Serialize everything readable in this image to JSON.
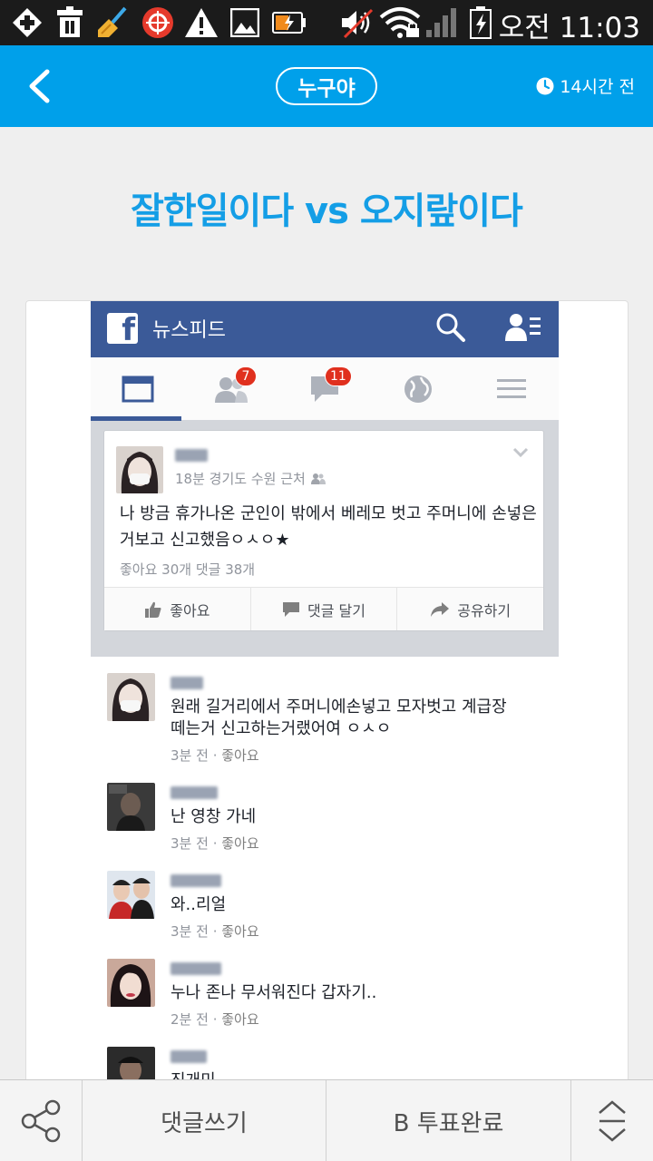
{
  "status_bar": {
    "time": "오전 11:03",
    "icons": [
      "add-icon",
      "trash-icon",
      "broom-icon",
      "app-icon",
      "warning-icon",
      "image-icon",
      "battery-charging-icon",
      "mute-icon",
      "wifi-icon",
      "signal-icon",
      "battery-icon"
    ]
  },
  "header": {
    "back_icon": "chevron-left-icon",
    "category": "누구야",
    "time_icon": "clock-icon",
    "time_ago": "14시간 전",
    "color": "#00a0ea"
  },
  "question": {
    "title": "잘한일이다 vs 오지랖이다",
    "color": "#149ee6"
  },
  "facebook": {
    "title": "뉴스피드",
    "tabs": [
      {
        "icon": "feed-icon"
      },
      {
        "icon": "friends-icon",
        "badge": "7"
      },
      {
        "icon": "messages-icon",
        "badge": "11"
      },
      {
        "icon": "globe-icon"
      },
      {
        "icon": "menu-icon"
      }
    ],
    "post": {
      "meta": "18분 경기도 수원 근처",
      "text": "나 방금 휴가나온 군인이 밖에서 베레모 벗고 주머니에 손넣은거보고 신고했음ㅇㅅㅇ★",
      "stats": "좋아요 30개  댓글 38개",
      "actions": {
        "like": "좋아요",
        "comment": "댓글 달기",
        "share": "공유하기"
      }
    },
    "comments": [
      {
        "text": "원래 길거리에서 주머니에손넣고 모자벗고 계급장떼는거 신고하는거랬어여 ㅇㅅㅇ",
        "time": "3분 전",
        "like": "좋아요"
      },
      {
        "text": "난 영창 가네",
        "time": "3분 전",
        "like": "좋아요"
      },
      {
        "text": "와..리얼",
        "time": "3분 전",
        "like": "좋아요"
      },
      {
        "text": "누나 존나 무서워진다 갑자기..",
        "time": "2분 전",
        "like": "좋아요"
      },
      {
        "text": "진개미"
      }
    ]
  },
  "bottom_bar": {
    "share_icon": "share-icon",
    "comment": "댓글쓰기",
    "vote": "B 투표완료",
    "sort_icon": "expand-collapse-icon"
  }
}
